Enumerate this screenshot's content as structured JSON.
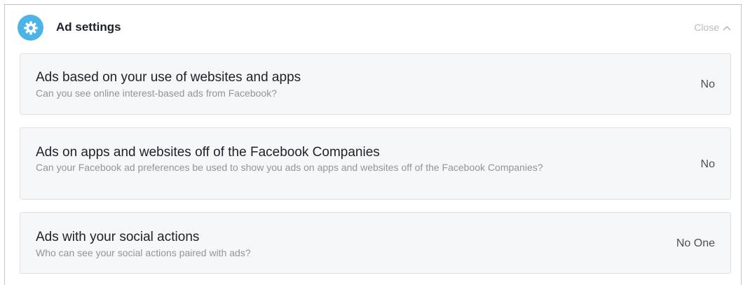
{
  "header": {
    "title": "Ad settings",
    "close_label": "Close",
    "accent_color": "#4cb4e6"
  },
  "settings": [
    {
      "title": "Ads based on your use of websites and apps",
      "description": "Can you see online interest-based ads from Facebook?",
      "value": "No"
    },
    {
      "title": "Ads on apps and websites off of the Facebook Companies",
      "description": "Can your Facebook ad preferences be used to show you ads on apps and websites off of the Facebook Companies?",
      "value": "No"
    },
    {
      "title": "Ads with your social actions",
      "description": "Who can see your social actions paired with ads?",
      "value": "No One"
    }
  ]
}
